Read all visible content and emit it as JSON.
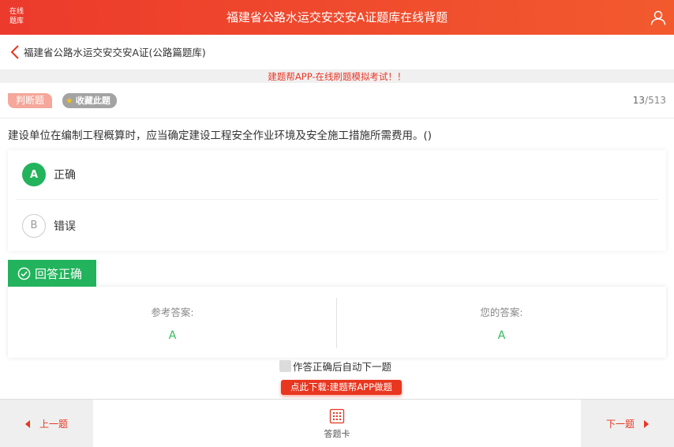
{
  "header": {
    "logo_line1": "在线",
    "logo_line2": "题库",
    "title": "福建省公路水运交安交安A证题库在线背题",
    "user_icon": "user-icon"
  },
  "breadcrumb": {
    "back_icon": "chevron-left-icon",
    "text": "福建省公路水运交安交安A证(公路篇题库)"
  },
  "notice": "建题帮APP-在线刷题模拟考试！！",
  "question_header": {
    "type_label": "判断题",
    "favorite_label": "收藏此题",
    "current": "13",
    "total": "/513"
  },
  "question": {
    "text": "建设单位在编制工程概算时，应当确定建设工程安全作业环境及安全施工措施所需费用。()",
    "options": [
      {
        "letter": "A",
        "text": "正确"
      },
      {
        "letter": "B",
        "text": "错误"
      }
    ]
  },
  "result": {
    "label": "回答正确",
    "reference_label": "参考答案:",
    "reference_value": "A",
    "your_label": "您的答案:",
    "your_value": "A"
  },
  "auto_next_label": "作答正确后自动下一题",
  "download_label": "点此下载:建题帮APP做题",
  "bottom_nav": {
    "prev_label": "上一题",
    "card_label": "答题卡",
    "next_label": "下一题"
  },
  "colors": {
    "brand_red": "#ec3a2c",
    "correct_green": "#22b35c",
    "accent_red": "#e8361f"
  }
}
